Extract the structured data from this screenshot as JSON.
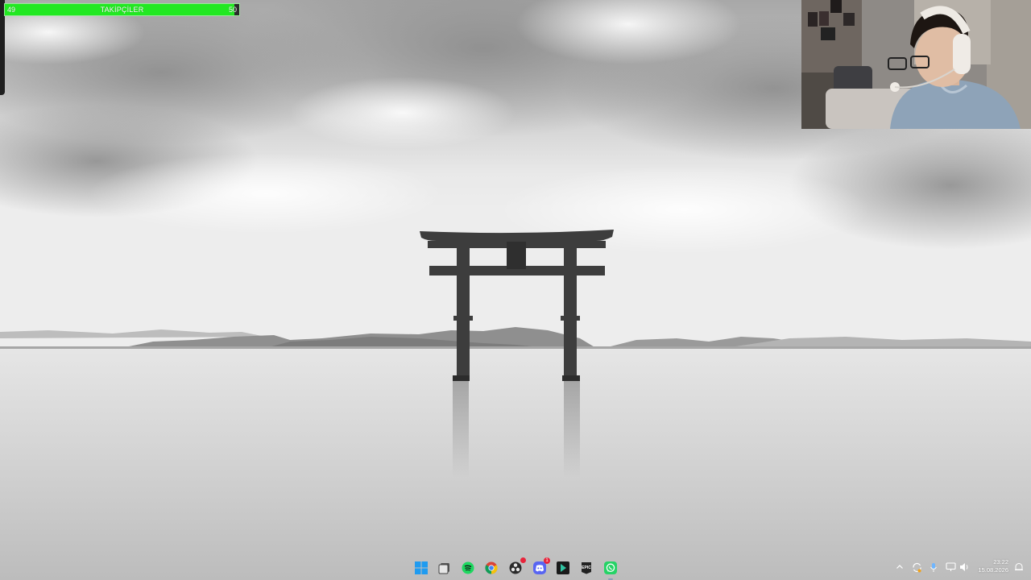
{
  "follower_goal": {
    "title": "TAKİPÇİLER",
    "current": "49",
    "target": "50",
    "progress": 0.98
  },
  "taskbar": {
    "apps": [
      {
        "name": "start",
        "icon": "windows-logo-icon"
      },
      {
        "name": "task-view",
        "icon": "task-view-icon"
      },
      {
        "name": "spotify",
        "icon": "spotify-icon"
      },
      {
        "name": "chrome",
        "icon": "chrome-icon"
      },
      {
        "name": "obs",
        "icon": "obs-icon"
      },
      {
        "name": "discord",
        "icon": "discord-icon",
        "badge": "1"
      },
      {
        "name": "streamlabs",
        "icon": "streamlabs-icon"
      },
      {
        "name": "epic-games",
        "icon": "epic-games-icon",
        "text": "EPIC"
      },
      {
        "name": "whatsapp",
        "icon": "whatsapp-icon",
        "active": true
      }
    ],
    "tray": [
      "chevron-up-icon",
      "update-icon",
      "microphone-icon",
      "monitor-icon",
      "speaker-icon"
    ],
    "clock": {
      "time": "23:22",
      "date": "15.08.2026"
    }
  },
  "colors": {
    "goal_fill": "#22e822",
    "goal_border": "#9ae79a",
    "taskbar_accent": "#8aa0b8"
  }
}
